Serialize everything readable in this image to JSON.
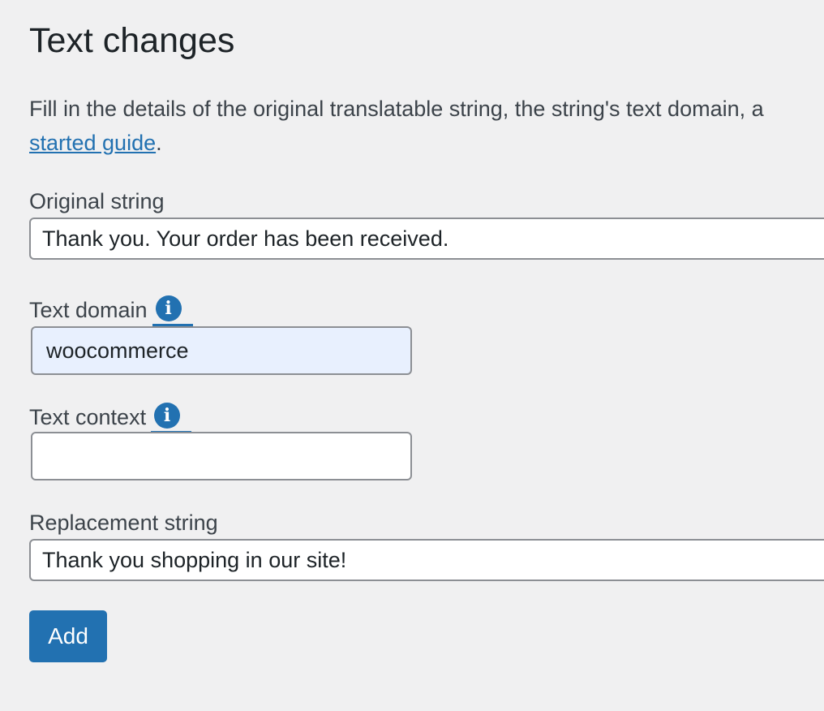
{
  "page": {
    "title": "Text changes",
    "intro_text": "Fill in the details of the original translatable string, the string's text domain, a",
    "intro_link": "started guide",
    "intro_end": "."
  },
  "fields": {
    "original": {
      "label": "Original string",
      "value": "Thank you. Your order has been received."
    },
    "domain": {
      "label": "Text domain",
      "value": "woocommerce",
      "help_icon": "info-icon"
    },
    "context": {
      "label": "Text context",
      "value": "",
      "help_icon": "info-icon"
    },
    "replacement": {
      "label": "Replacement string",
      "value": "Thank you shopping in our site!"
    }
  },
  "actions": {
    "add_label": "Add"
  },
  "colors": {
    "accent": "#2271b1",
    "background": "#f0f0f1",
    "autofill": "#e8f0fe"
  }
}
